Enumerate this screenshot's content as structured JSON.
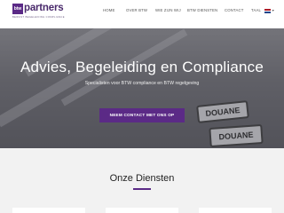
{
  "header": {
    "logo": {
      "box_text": "btw",
      "word": "partners",
      "tagline": "BEWUST BEGELEIDING COMPLIANCE"
    },
    "nav": {
      "items": [
        {
          "label": "HOME"
        },
        {
          "label": "OVER BTW"
        },
        {
          "label": "WIE ZIJN WIJ"
        },
        {
          "label": "BTW DIENSTEN"
        },
        {
          "label": "CONTACT"
        },
        {
          "label": "TAAL"
        }
      ],
      "flag_colors": [
        "#ae1c28",
        "#ffffff",
        "#21468b"
      ]
    }
  },
  "hero": {
    "title": "Advies, Begeleiding en Compliance",
    "subtitle": "Specialisten voor BTW compliance en BTW regelgeving",
    "cta_label": "NEEM CONTACT MET ONS OP",
    "sign_text_1": "DOUANE",
    "sign_text_2": "DOUANE"
  },
  "services": {
    "title": "Onze Diensten"
  },
  "colors": {
    "brand": "#5b2a86",
    "header_bg": "#ffffff",
    "page_bg": "#f2f2f2"
  }
}
